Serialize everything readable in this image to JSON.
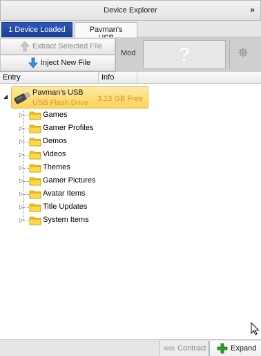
{
  "window": {
    "title": "Device Explorer",
    "collapse_glyph": "»"
  },
  "tabs": [
    {
      "label": "1 Device Loaded"
    },
    {
      "label": "Pavman's USB"
    }
  ],
  "toolbar": {
    "extract_label": "Extract Selected File",
    "inject_label": "Inject New File",
    "mod_label": "Mod",
    "mod_placeholder": "?"
  },
  "columns": {
    "entry": "Entry",
    "info": "Info"
  },
  "tree": {
    "root": {
      "name": "Pavman's USB",
      "type": "USB Flash Drive",
      "free": "3.13 GB Free"
    },
    "folders": [
      {
        "label": "Games"
      },
      {
        "label": "Gamer Profiles"
      },
      {
        "label": "Demos"
      },
      {
        "label": "Videos"
      },
      {
        "label": "Themes"
      },
      {
        "label": "Gamer Pictures"
      },
      {
        "label": "Avatar Items"
      },
      {
        "label": "Title Updates"
      },
      {
        "label": "System Items"
      }
    ]
  },
  "footer": {
    "contract_label": "Contract",
    "expand_label": "Expand"
  },
  "colors": {
    "active_tab": "#1a3e95",
    "selection": "#fbd45a",
    "folder": "#f5c518",
    "expand_plus": "#2ea02e"
  }
}
